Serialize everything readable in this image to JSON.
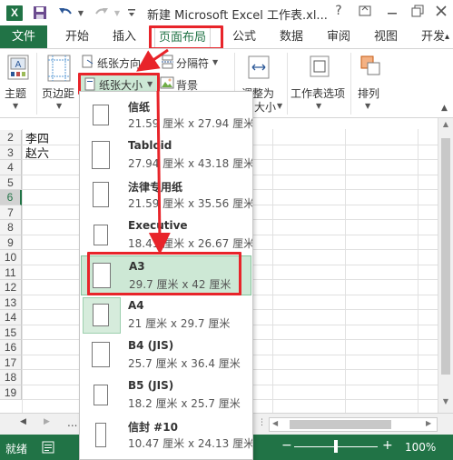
{
  "titlebar": {
    "title": "新建 Microsoft Excel 工作表.xl...",
    "help": "?"
  },
  "tabs": [
    {
      "label": "文件"
    },
    {
      "label": "开始"
    },
    {
      "label": "插入"
    },
    {
      "label": "页面布局"
    },
    {
      "label": "公式"
    },
    {
      "label": "数据"
    },
    {
      "label": "审阅"
    },
    {
      "label": "视图"
    },
    {
      "label": "开发"
    }
  ],
  "ribbon": {
    "theme": "主题",
    "margins": "页边距",
    "orientation": "纸张方向",
    "size": "纸张大小",
    "breaks": "分隔符",
    "background": "背景",
    "scale_line1": "调整为",
    "scale_line2": "大小",
    "sheet_options": "工作表选项",
    "arrange": "排列"
  },
  "grid": {
    "rows": [
      "2",
      "3",
      "4",
      "5",
      "6",
      "7",
      "8",
      "9",
      "10",
      "11",
      "12",
      "13",
      "14",
      "15",
      "16",
      "17",
      "18",
      "19"
    ],
    "selected_row": "6",
    "cells": [
      {
        "row": "2",
        "text": "李四"
      },
      {
        "row": "3",
        "text": "赵六"
      }
    ]
  },
  "paper_sizes": [
    {
      "name": "信纸",
      "size": "21.59 厘米 x 27.94 厘米"
    },
    {
      "name": "Tabloid",
      "size": "27.94 厘米 x 43.18 厘米"
    },
    {
      "name": "法律专用纸",
      "size": "21.59 厘米 x 35.56 厘米"
    },
    {
      "name": "Executive",
      "size": "18.41 厘米 x 26.67 厘米"
    },
    {
      "name": "A3",
      "size": "29.7 厘米 x 42 厘米"
    },
    {
      "name": "A4",
      "size": "21 厘米 x 29.7 厘米"
    },
    {
      "name": "B4 (JIS)",
      "size": "25.7 厘米 x 36.4 厘米"
    },
    {
      "name": "B5 (JIS)",
      "size": "18.2 厘米 x 25.7 厘米"
    },
    {
      "name": "信封 #10",
      "size": "10.47 厘米 x 24.13 厘米"
    }
  ],
  "hovered_paper": "A3",
  "current_paper": "A4",
  "sheet_nav": {
    "more": "..."
  },
  "status": {
    "ready": "就绪",
    "zoom": "100%",
    "zoom_minus": "−",
    "zoom_plus": "+"
  },
  "colors": {
    "excel_green": "#217346",
    "highlight_red": "#e8242a",
    "hover_green": "#cde8d5"
  }
}
